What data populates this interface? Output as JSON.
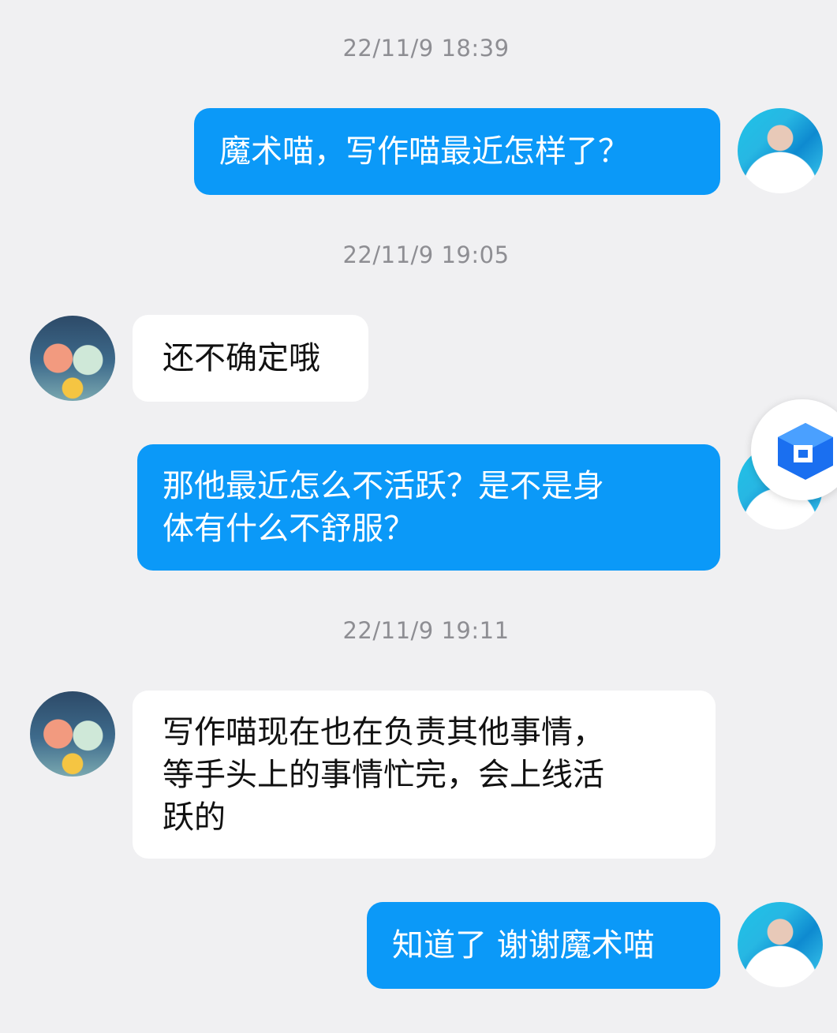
{
  "messages": [
    {
      "type": "timestamp",
      "text": "22/11/9 18:39"
    },
    {
      "type": "sent",
      "text": "魔术喵，写作喵最近怎样了？"
    },
    {
      "type": "timestamp",
      "text": "22/11/9 19:05"
    },
    {
      "type": "received",
      "text": "还不确定哦"
    },
    {
      "type": "sent",
      "lines": [
        "那他最近怎么不活跃？是不是身",
        "体有什么不舒服？"
      ]
    },
    {
      "type": "timestamp",
      "text": "22/11/9 19:11"
    },
    {
      "type": "received",
      "lines": [
        "写作喵现在也在负责其他事情，",
        "等手头上的事情忙完，会上线活",
        "跃的"
      ]
    },
    {
      "type": "sent",
      "text": "知道了 谢谢魔术喵"
    }
  ],
  "colors": {
    "background": "#f0f0f2",
    "sent_bubble": "#0b99f8",
    "received_bubble": "#ffffff",
    "timestamp": "#8e8e93"
  },
  "icons": {
    "floating": "app-logo-icon",
    "me_avatar": "user-avatar",
    "contact_avatar": "cat-avatar"
  }
}
